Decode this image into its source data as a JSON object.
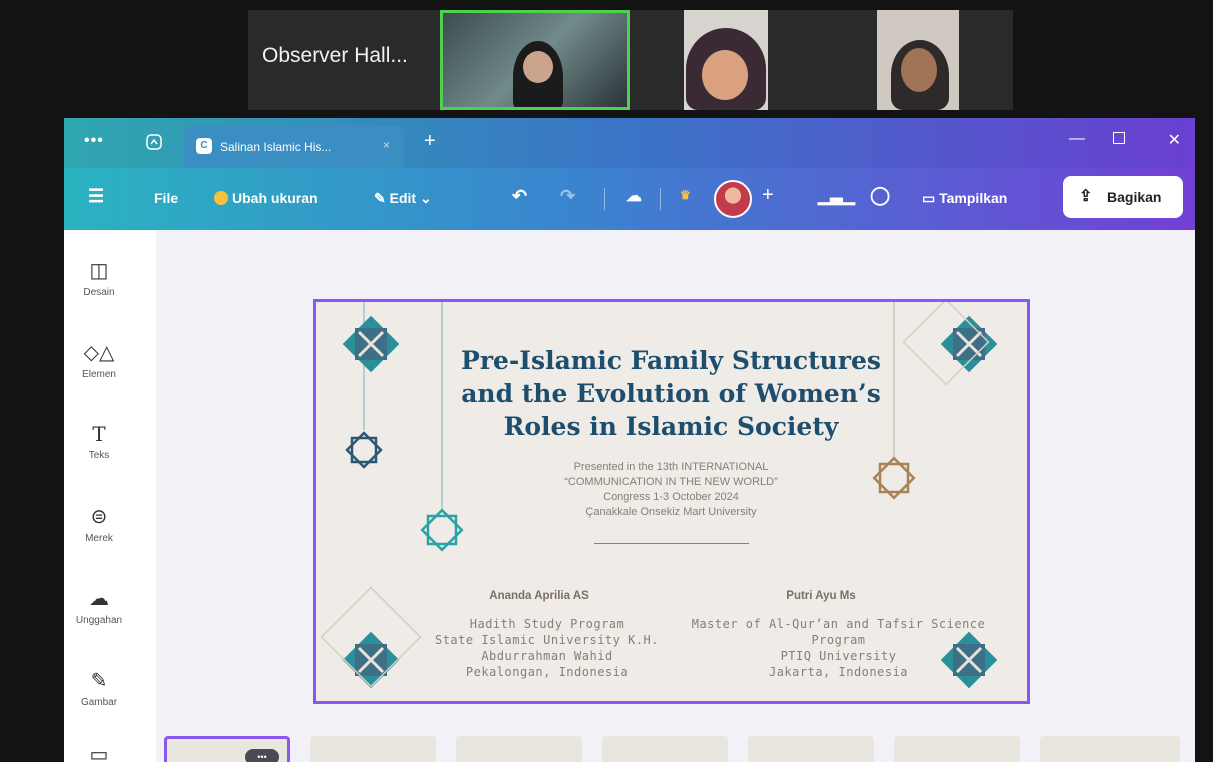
{
  "meeting": {
    "observer_label": "Observer Hall..."
  },
  "window": {
    "tab_title": "Salinan Islamic His...",
    "tab_close": "×",
    "new_tab": "+"
  },
  "toolbar": {
    "file": "File",
    "resize": "Ubah ukuran",
    "edit": "Edit",
    "present": "Tampilkan",
    "share": "Bagikan"
  },
  "sidebar": {
    "items": [
      {
        "label": "Desain",
        "icon": "layout-icon"
      },
      {
        "label": "Elemen",
        "icon": "shapes-icon"
      },
      {
        "label": "Teks",
        "icon": "text-icon"
      },
      {
        "label": "Merek",
        "icon": "brand-icon"
      },
      {
        "label": "Unggahan",
        "icon": "upload-icon"
      },
      {
        "label": "Gambar",
        "icon": "draw-icon"
      }
    ]
  },
  "slide": {
    "title_line1": "Pre-Islamic Family Structures",
    "title_line2": "and the Evolution of Women’s",
    "title_line3": "Roles in Islamic Society",
    "presented_line1": "Presented in the 13th INTERNATIONAL",
    "presented_line2": "“COMMUNICATION IN THE NEW WORLD”",
    "presented_line3": "Congress 1-3 October 2024",
    "presented_line4": "Çanakkale Onsekiz Mart University",
    "author1": {
      "name": "Ananda Aprilia AS",
      "line1": "Hadith Study Program",
      "line2": "State Islamic University K.H.",
      "line3": "Abdurrahman Wahid",
      "line4": "Pekalongan, Indonesia"
    },
    "author2": {
      "name": "Putri Ayu Ms",
      "line1": "Master of Al-Qur’an and Tafsir Science",
      "line2": "Program",
      "line3": "PTIQ University",
      "line4": "Jakarta, Indonesia"
    }
  },
  "thumbs": {
    "more": "•••"
  },
  "colors": {
    "accent": "#8a57f0",
    "title": "#1e4e6e",
    "teal": "#2aa3a7"
  }
}
